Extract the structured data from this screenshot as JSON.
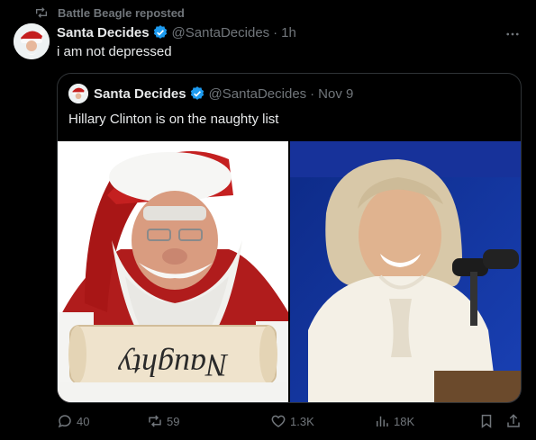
{
  "repost": {
    "text": "Battle Beagle reposted"
  },
  "post": {
    "author_name": "Santa Decides",
    "handle": "@SantaDecides",
    "separator": "·",
    "time": "1h",
    "text": "i am not depressed"
  },
  "quote": {
    "author_name": "Santa Decides",
    "handle": "@SantaDecides",
    "separator": "·",
    "time": "Nov 9",
    "text": "Hillary Clinton is on the naughty list",
    "scroll_text": "Naughty"
  },
  "actions": {
    "replies": "40",
    "reposts": "59",
    "likes": "1.3K",
    "views": "18K"
  },
  "colors": {
    "background": "#000000",
    "text": "#e7e9ea",
    "muted": "#71767b",
    "verified": "#1d9bf0",
    "border": "#2f3336"
  },
  "icons": [
    "repost-icon",
    "verified-icon",
    "more-icon",
    "reply-icon",
    "like-icon",
    "views-icon",
    "bookmark-icon",
    "share-icon"
  ]
}
